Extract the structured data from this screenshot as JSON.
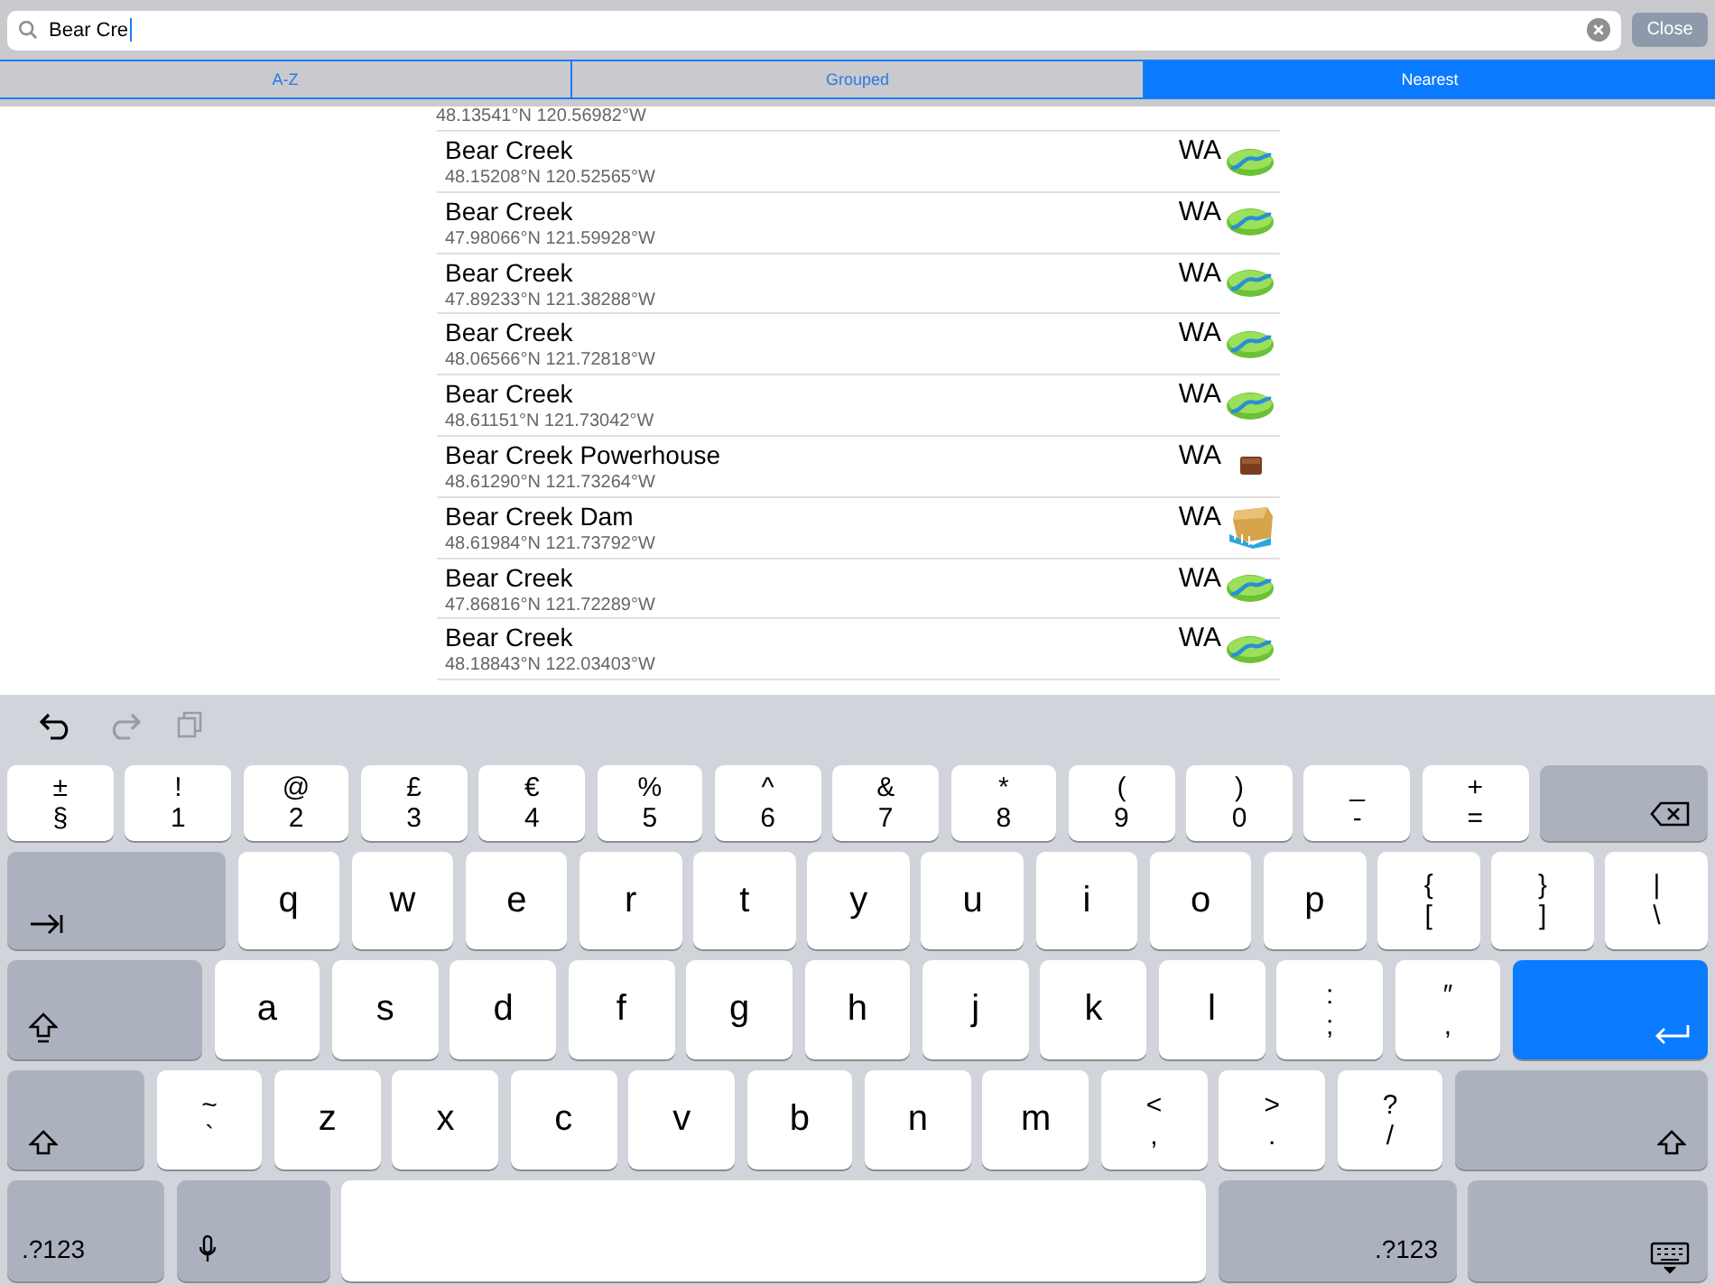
{
  "search": {
    "value": "Bear Cre",
    "close": "Close"
  },
  "tabs": [
    {
      "label": "A-Z",
      "selected": false
    },
    {
      "label": "Grouped",
      "selected": false
    },
    {
      "label": "Nearest",
      "selected": true
    }
  ],
  "partial_row": {
    "coordinates": "48.13541°N 120.56982°W"
  },
  "results": [
    {
      "name": "Bear Creek",
      "coordinates": "48.15208°N 120.52565°W",
      "state": "WA",
      "kind": "creek"
    },
    {
      "name": "Bear Creek",
      "coordinates": "47.98066°N 121.59928°W",
      "state": "WA",
      "kind": "creek"
    },
    {
      "name": "Bear Creek",
      "coordinates": "47.89233°N 121.38288°W",
      "state": "WA",
      "kind": "creek"
    },
    {
      "name": "Bear Creek",
      "coordinates": "48.06566°N 121.72818°W",
      "state": "WA",
      "kind": "creek"
    },
    {
      "name": "Bear Creek",
      "coordinates": "48.61151°N 121.73042°W",
      "state": "WA",
      "kind": "creek"
    },
    {
      "name": "Bear Creek Powerhouse",
      "coordinates": "48.61290°N 121.73264°W",
      "state": "WA",
      "kind": "powerhouse"
    },
    {
      "name": "Bear Creek Dam",
      "coordinates": "48.61984°N 121.73792°W",
      "state": "WA",
      "kind": "dam"
    },
    {
      "name": "Bear Creek",
      "coordinates": "47.86816°N 121.72289°W",
      "state": "WA",
      "kind": "creek"
    },
    {
      "name": "Bear Creek",
      "coordinates": "48.18843°N 122.03403°W",
      "state": "WA",
      "kind": "creek"
    }
  ],
  "toolbar": [
    {
      "kind": "undo",
      "disabled": false
    },
    {
      "kind": "redo",
      "disabled": true
    },
    {
      "kind": "paste",
      "disabled": true
    }
  ],
  "keyboard": [
    [
      {
        "kind": "pair",
        "top": "±",
        "main": "§"
      },
      {
        "kind": "pair",
        "top": "!",
        "main": "1"
      },
      {
        "kind": "pair",
        "top": "@",
        "main": "2"
      },
      {
        "kind": "pair",
        "top": "£",
        "main": "3"
      },
      {
        "kind": "pair",
        "top": "€",
        "main": "4"
      },
      {
        "kind": "pair",
        "top": "%",
        "main": "5"
      },
      {
        "kind": "pair",
        "top": "^",
        "main": "6"
      },
      {
        "kind": "pair",
        "top": "&",
        "main": "7"
      },
      {
        "kind": "pair",
        "top": "*",
        "main": "8"
      },
      {
        "kind": "pair",
        "top": "(",
        "main": "9"
      },
      {
        "kind": "pair",
        "top": ")",
        "main": "0"
      },
      {
        "kind": "pair",
        "top": "_",
        "main": "-"
      },
      {
        "kind": "pair",
        "top": "+",
        "main": "="
      },
      {
        "kind": "delete"
      }
    ],
    [
      {
        "kind": "tab"
      },
      {
        "kind": "char",
        "main": "q"
      },
      {
        "kind": "char",
        "main": "w"
      },
      {
        "kind": "char",
        "main": "e"
      },
      {
        "kind": "char",
        "main": "r"
      },
      {
        "kind": "char",
        "main": "t"
      },
      {
        "kind": "char",
        "main": "y"
      },
      {
        "kind": "char",
        "main": "u"
      },
      {
        "kind": "char",
        "main": "i"
      },
      {
        "kind": "char",
        "main": "o"
      },
      {
        "kind": "char",
        "main": "p"
      },
      {
        "kind": "pair",
        "top": "{",
        "main": "["
      },
      {
        "kind": "pair",
        "top": "}",
        "main": "]"
      },
      {
        "kind": "pair",
        "top": "|",
        "main": "\\"
      }
    ],
    [
      {
        "kind": "caps"
      },
      {
        "kind": "char",
        "main": "a"
      },
      {
        "kind": "char",
        "main": "s"
      },
      {
        "kind": "char",
        "main": "d"
      },
      {
        "kind": "char",
        "main": "f"
      },
      {
        "kind": "char",
        "main": "g"
      },
      {
        "kind": "char",
        "main": "h"
      },
      {
        "kind": "char",
        "main": "j"
      },
      {
        "kind": "char",
        "main": "k"
      },
      {
        "kind": "char",
        "main": "l"
      },
      {
        "kind": "pair",
        "top": ":",
        "main": ";"
      },
      {
        "kind": "pair",
        "top": "″",
        "main": ","
      },
      {
        "kind": "return"
      }
    ],
    [
      {
        "kind": "shift"
      },
      {
        "kind": "pair",
        "top": "~",
        "main": "`"
      },
      {
        "kind": "char",
        "main": "z"
      },
      {
        "kind": "char",
        "main": "x"
      },
      {
        "kind": "char",
        "main": "c"
      },
      {
        "kind": "char",
        "main": "v"
      },
      {
        "kind": "char",
        "main": "b"
      },
      {
        "kind": "char",
        "main": "n"
      },
      {
        "kind": "char",
        "main": "m"
      },
      {
        "kind": "pair",
        "top": "<",
        "main": ","
      },
      {
        "kind": "pair",
        "top": ">",
        "main": "."
      },
      {
        "kind": "pair",
        "top": "?",
        "main": "/"
      },
      {
        "kind": "shift-right"
      }
    ],
    [
      {
        "kind": "numbers",
        "label": ".?123"
      },
      {
        "kind": "mic"
      },
      {
        "kind": "space"
      },
      {
        "kind": "numbers-right",
        "label": ".?123"
      },
      {
        "kind": "hide"
      }
    ]
  ]
}
